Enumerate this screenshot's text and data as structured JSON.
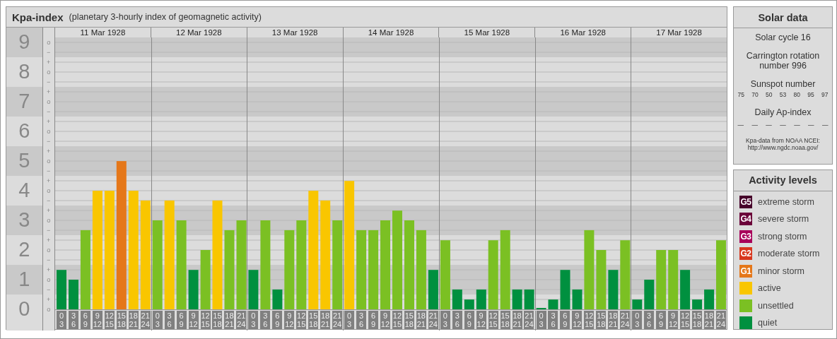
{
  "kp_chart": {
    "title": "Kpa-index",
    "subtitle": "(planetary 3-hourly index of geomagnetic activity)",
    "days": [
      "11 Mar 1928",
      "12 Mar 1928",
      "13 Mar 1928",
      "14 Mar 1928",
      "15 Mar 1928",
      "16 Mar 1928",
      "17 Mar 1928"
    ],
    "subdivision_marks": [
      [
        "o",
        "−"
      ],
      [
        "+",
        "o",
        "−"
      ],
      [
        "+",
        "o",
        "−"
      ],
      [
        "+",
        "o",
        "−"
      ],
      [
        "+",
        "o",
        "−"
      ],
      [
        "+",
        "o",
        "−"
      ],
      [
        "+",
        "o",
        "−"
      ],
      [
        "+",
        "o",
        "−"
      ],
      [
        "+",
        "o",
        "−"
      ],
      [
        "+",
        "o"
      ]
    ],
    "chart_data": {
      "type": "bar",
      "grid": true,
      "ylim": [
        0,
        9.17
      ],
      "yticks": [
        {
          "value": 9,
          "label": "9"
        },
        {
          "value": 8,
          "label": "8"
        },
        {
          "value": 7,
          "label": "7"
        },
        {
          "value": 6,
          "label": "6"
        },
        {
          "value": 5,
          "label": "5"
        },
        {
          "value": 4,
          "label": "4"
        },
        {
          "value": 3,
          "label": "3"
        },
        {
          "value": 2,
          "label": "2"
        },
        {
          "value": 1,
          "label": "1"
        },
        {
          "value": 0,
          "label": "0"
        }
      ],
      "categories": [
        "0 3",
        "3 6",
        "6 9",
        "9 12",
        "12 15",
        "15 18",
        "18 21",
        "21 24",
        "0 3",
        "3 6",
        "6 9",
        "9 12",
        "12 15",
        "15 18",
        "18 21",
        "21 24",
        "0 3",
        "3 6",
        "6 9",
        "9 12",
        "12 15",
        "15 18",
        "18 21",
        "21 24",
        "0 3",
        "3 6",
        "6 9",
        "9 12",
        "12 15",
        "15 18",
        "18 21",
        "21 24",
        "0 3",
        "3 6",
        "6 9",
        "9 12",
        "12 15",
        "15 18",
        "18 21",
        "21 24",
        "0 3",
        "3 6",
        "6 9",
        "9 12",
        "12 15",
        "15 18",
        "18 21",
        "21 24",
        "0 3",
        "3 6",
        "6 9",
        "9 12",
        "12 15",
        "15 18",
        "18 21",
        "21 24"
      ],
      "series": [
        {
          "values": [
            1.33,
            1,
            2.67,
            4,
            4,
            5,
            4,
            3.67,
            3,
            3.67,
            3,
            1.33,
            2,
            3.67,
            2.67,
            3,
            1.33,
            3,
            0.67,
            2.67,
            3,
            4,
            3.67,
            3,
            4.33,
            2.67,
            2.67,
            3,
            3.33,
            3,
            2.67,
            1.33,
            2.33,
            0.67,
            0.33,
            0.67,
            2.33,
            2.67,
            0.67,
            0.67,
            0,
            0.33,
            1.33,
            0.67,
            2.67,
            2,
            1.33,
            2.33,
            0.33,
            1,
            2,
            2,
            1.33,
            0.33,
            0.67,
            2.33
          ]
        }
      ]
    }
  },
  "solar_data": {
    "title": "Solar data",
    "solar_cycle": "Solar cycle 16",
    "carrington_rotation": "Carrington rotation number 996",
    "sunspot_label": "Sunspot number",
    "sunspot_numbers": [
      "75",
      "70",
      "50",
      "53",
      "80",
      "95",
      "97"
    ],
    "ap_label": "Daily Ap-index",
    "ap_values": [
      "—",
      "—",
      "—",
      "—",
      "—",
      "—",
      "—"
    ],
    "source": "Kpa-data from NOAA NCEI:",
    "source_url": "http://www.ngdc.noaa.gov/"
  },
  "activity_levels": {
    "title": "Activity levels",
    "items": [
      {
        "badge": "G5",
        "label": "extreme storm",
        "color": "#46002a"
      },
      {
        "badge": "G4",
        "label": "severe storm",
        "color": "#6b0039"
      },
      {
        "badge": "G3",
        "label": "strong storm",
        "color": "#a8005a"
      },
      {
        "badge": "G2",
        "label": "moderate storm",
        "color": "#d8361d"
      },
      {
        "badge": "G1",
        "label": "minor storm",
        "color": "#e57719"
      },
      {
        "label": "active",
        "color": "#f9c600"
      },
      {
        "label": "unsettled",
        "color": "#7bc023"
      },
      {
        "label": "quiet",
        "color": "#00903f"
      }
    ]
  }
}
